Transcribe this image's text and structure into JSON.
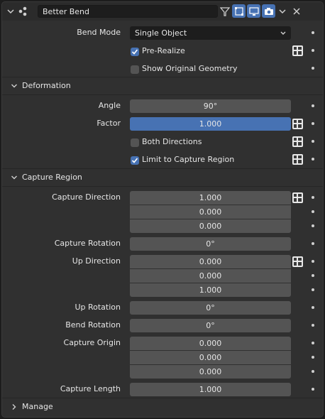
{
  "header": {
    "modifier_name": "Better Bend",
    "icons": [
      "chevron-down-icon",
      "geometry-nodes-icon",
      "node-tree-icon",
      "edit-mode-icon",
      "viewport-display-icon",
      "render-icon",
      "dropdown-icon",
      "close-icon"
    ]
  },
  "main": {
    "bend_mode": {
      "label": "Bend Mode",
      "value": "Single Object"
    },
    "pre_realize": {
      "label": "Pre-Realize",
      "checked": true
    },
    "show_original": {
      "label": "Show Original Geometry",
      "checked": false
    }
  },
  "deformation": {
    "title": "Deformation",
    "angle": {
      "label": "Angle",
      "value": "90°"
    },
    "factor": {
      "label": "Factor",
      "value": "1.000"
    },
    "both_directions": {
      "label": "Both Directions",
      "checked": false
    },
    "limit_capture": {
      "label": "Limit to Capture Region",
      "checked": true
    }
  },
  "capture_region": {
    "title": "Capture Region",
    "capture_direction": {
      "label": "Capture Direction",
      "values": [
        "1.000",
        "0.000",
        "0.000"
      ]
    },
    "capture_rotation": {
      "label": "Capture Rotation",
      "value": "0°"
    },
    "up_direction": {
      "label": "Up Direction",
      "values": [
        "0.000",
        "0.000",
        "1.000"
      ]
    },
    "up_rotation": {
      "label": "Up Rotation",
      "value": "0°"
    },
    "bend_rotation": {
      "label": "Bend Rotation",
      "value": "0°"
    },
    "capture_origin": {
      "label": "Capture Origin",
      "values": [
        "0.000",
        "0.000",
        "0.000"
      ]
    },
    "capture_length": {
      "label": "Capture Length",
      "value": "1.000"
    }
  },
  "manage": {
    "title": "Manage"
  },
  "colors": {
    "accent": "#4772b3",
    "panel": "#303030",
    "field": "#545454",
    "dropdown": "#1d1d1d"
  }
}
